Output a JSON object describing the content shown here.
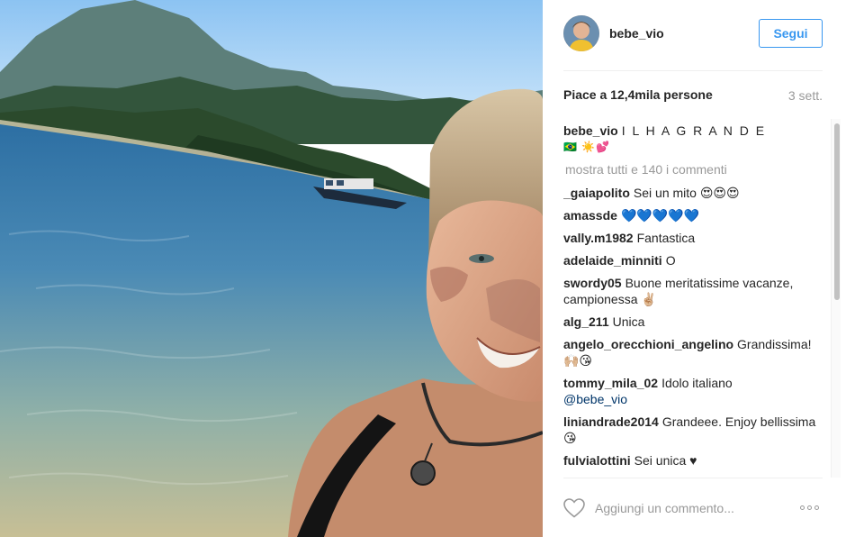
{
  "post": {
    "username": "bebe_vio",
    "follow_label": "Segui",
    "likes_text": "Piace a 12,4mila persone",
    "age": "3 sett.",
    "caption_text": "I L H A G R A N D E",
    "caption_emoji": "🇧🇷   ☀️💕",
    "view_all_comments": "mostra tutti e 140 i commenti",
    "comment_placeholder": "Aggiungi un commento...",
    "more_label": "..."
  },
  "comments": [
    {
      "user": "_gaiapolito",
      "text": "Sei un mito 😍😍😍"
    },
    {
      "user": "amassde",
      "text": "💙💙💙💙💙"
    },
    {
      "user": "vally.m1982",
      "text": "Fantastica"
    },
    {
      "user": "adelaide_minniti",
      "text": "O"
    },
    {
      "user": "swordy05",
      "text": "Buone meritatissime vacanze, campionessa ✌🏼"
    },
    {
      "user": "alg_211",
      "text": "Unica"
    },
    {
      "user": "angelo_orecchioni_angelino",
      "text": "Grandissima! 🙌🏼😘"
    },
    {
      "user": "tommy_mila_02",
      "text": "Idolo italiano",
      "mention": "@bebe_vio"
    },
    {
      "user": "liniandrade2014",
      "text": "Grandeee. Enjoy bellissima 😘"
    },
    {
      "user": "fulvialottini",
      "text": "Sei unica ♥"
    }
  ],
  "icons": {
    "like": "heart-icon",
    "more": "ellipsis-icon"
  },
  "colors": {
    "accent": "#3897f0",
    "text": "#262626",
    "muted": "#999999",
    "sky": "#a9d3f5",
    "water": "#3e7fb0"
  }
}
